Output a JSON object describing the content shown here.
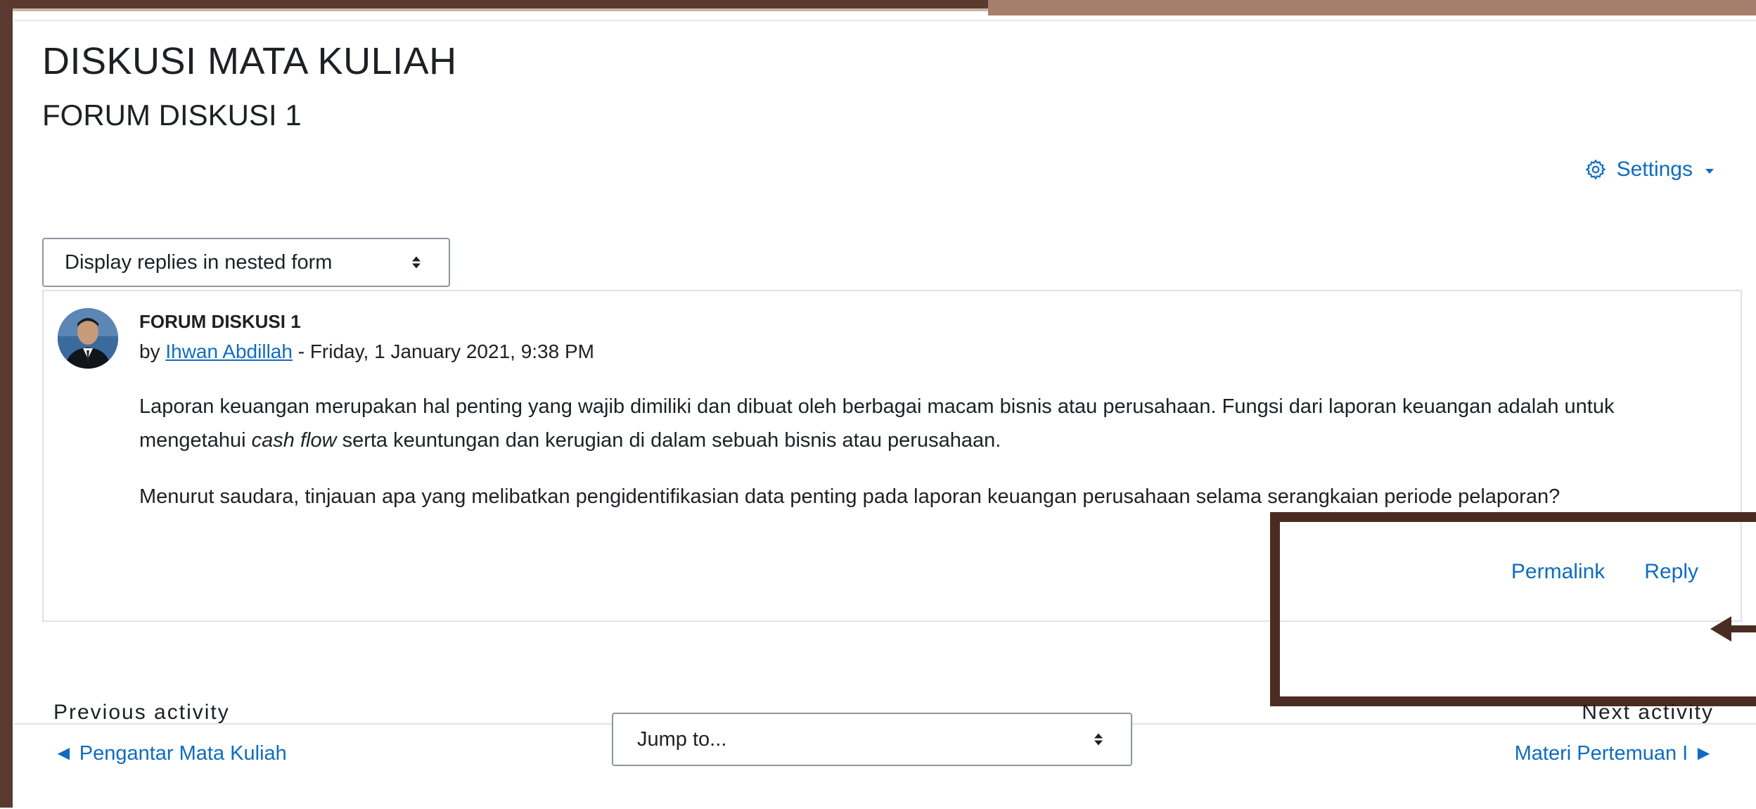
{
  "course": {
    "title": "DISKUSI MATA KULIAH"
  },
  "forum": {
    "title": "FORUM DISKUSI 1"
  },
  "settings": {
    "label": "Settings",
    "icon": "gear-icon"
  },
  "display_mode": {
    "selected": "Display replies in nested form"
  },
  "post": {
    "subject": "FORUM DISKUSI 1",
    "by_prefix": "by",
    "author": "Ihwan Abdillah",
    "separator": " - ",
    "date": "Friday, 1 January 2021, 9:38 PM",
    "body_p1_a": "Laporan keuangan merupakan hal penting yang wajib dimiliki dan dibuat oleh berbagai macam bisnis atau perusahaan. Fungsi dari laporan keuangan adalah untuk mengetahui ",
    "body_p1_em": "cash flow",
    "body_p1_b": " serta keuntungan dan kerugian di dalam sebuah bisnis atau perusahaan.",
    "body_p2": "Menurut saudara, tinjauan apa yang melibatkan pengidentifikasian data penting pada laporan keuangan perusahaan selama serangkaian periode pelaporan?",
    "actions": {
      "permalink": "Permalink",
      "reply": "Reply"
    }
  },
  "navigation": {
    "previous_label": "Previous activity",
    "previous_link": "◄ Pengantar Mata Kuliah",
    "jump_placeholder": "Jump to...",
    "next_label": "Next activity",
    "next_link": "Materi Pertemuan I ►"
  },
  "colors": {
    "link": "#0f6cbf",
    "frame_brown": "#5a3a2e",
    "annotation_brown": "#4a2c22",
    "text": "#1d2125"
  }
}
